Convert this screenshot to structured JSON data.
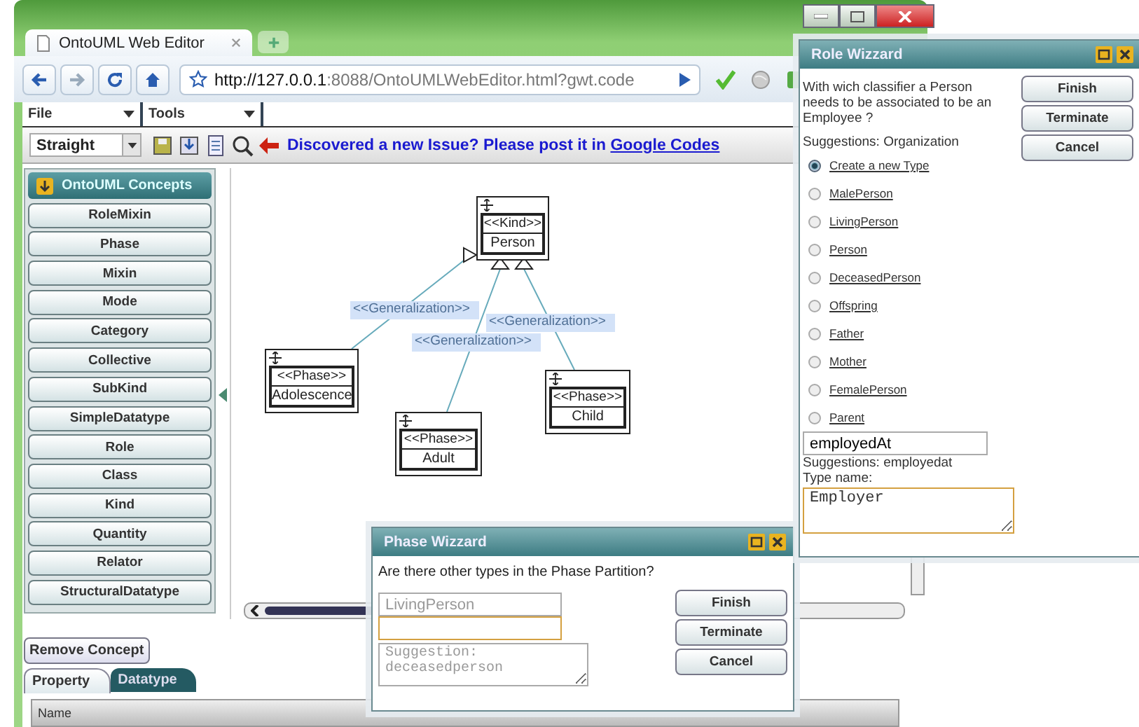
{
  "browser": {
    "tab_title": "OntoUML Web Editor",
    "url_host": "http://127.0.0.1",
    "url_rest": ":8088/OntoUMLWebEditor.html?gwt.code"
  },
  "menu": [
    {
      "label": "File"
    },
    {
      "label": "Tools"
    }
  ],
  "toolbar": {
    "line_style": "Straight",
    "notice": "Discovered a new Issue? Please post it in",
    "link": "Google Codes"
  },
  "concepts": {
    "title": "OntoUML Concepts",
    "items": [
      "RoleMixin",
      "Phase",
      "Mixin",
      "Mode",
      "Category",
      "Collective",
      "SubKind",
      "SimpleDatatype",
      "Role",
      "Class",
      "Kind",
      "Quantity",
      "Relator",
      "StructuralDatatype"
    ]
  },
  "diagram": {
    "classes": [
      {
        "stereotype": "<<Kind>>",
        "name": "Person"
      },
      {
        "stereotype": "<<Phase>>",
        "name": "Adolescence"
      },
      {
        "stereotype": "<<Phase>>",
        "name": "Adult"
      },
      {
        "stereotype": "<<Phase>>",
        "name": "Child"
      }
    ],
    "generalizations": [
      "<<Generalization>>",
      "<<Generalization>>",
      "<<Generalization>>"
    ]
  },
  "remove_button": "Remove Concept",
  "tabs": [
    {
      "label": "Property",
      "selected": true
    },
    {
      "label": "Datatype",
      "selected": false
    }
  ],
  "table": {
    "columns": [
      "Name"
    ]
  },
  "phase_wizard": {
    "title": "Phase Wizzard",
    "question": "Are there other types in the Phase Partition?",
    "previous_type": "LivingPerson",
    "new_type": {
      "focused": true
    },
    "suggestion_placeholder": "Suggestion:\ndeceasedperson",
    "buttons": [
      "Finish",
      "Terminate",
      "Cancel"
    ]
  },
  "role_wizard": {
    "title": "Role Wizzard",
    "question": "With wich classifier a Person needs to be associated to be an Employee ?",
    "suggestions": "Suggestions: Organization",
    "options": [
      {
        "label": "Create a new Type",
        "selected": true
      },
      {
        "label": "MalePerson",
        "selected": false
      },
      {
        "label": "LivingPerson",
        "selected": false
      },
      {
        "label": "Person",
        "selected": false
      },
      {
        "label": "DeceasedPerson",
        "selected": false
      },
      {
        "label": "Offspring",
        "selected": false
      },
      {
        "label": "Father",
        "selected": false
      },
      {
        "label": "Mother",
        "selected": false
      },
      {
        "label": "FemalePerson",
        "selected": false
      },
      {
        "label": "Parent",
        "selected": false
      }
    ],
    "relation_name": "employedAt",
    "relation_suggestions": "Suggestions: employedat",
    "type_label": "Type name:",
    "type_name": {
      "value": "Employer",
      "focused": true
    },
    "buttons": [
      "Finish",
      "Terminate",
      "Cancel"
    ]
  }
}
